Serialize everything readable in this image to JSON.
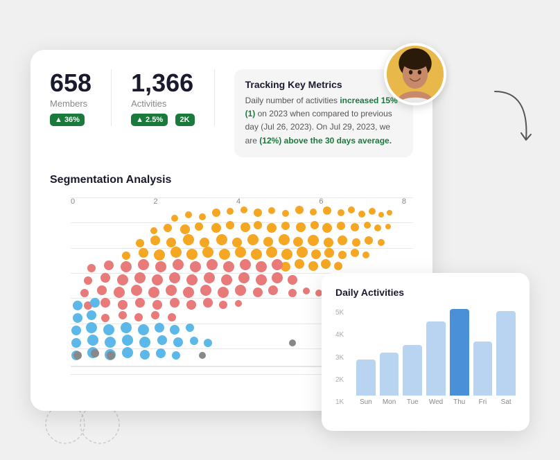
{
  "metrics": {
    "members": {
      "number": "658",
      "label": "Members",
      "badge": "▲ 36%"
    },
    "activities": {
      "number": "1,366",
      "label": "Activities",
      "badge": "▲ 2.5%",
      "badge2": "2K"
    }
  },
  "tracking": {
    "title": "Tracking Key Metrics",
    "text_before": "Daily number of activities ",
    "highlight1": "increased 15% (1)",
    "text_mid1": "\non 2023 when compared to previous day (Jul\n26, 2023). On Jul 29, 2023, we are ",
    "highlight2": "(12%) above\nthe 30 days average.",
    "text_mid2": ""
  },
  "segmentation": {
    "title": "Segmentation Analysis",
    "xLabels": [
      "0",
      "2",
      "4",
      "6",
      "8"
    ]
  },
  "daily": {
    "title": "Daily Activities",
    "yLabels": [
      "5K",
      "4K",
      "3K",
      "2K",
      "1K"
    ],
    "bars": [
      {
        "label": "Sun",
        "value": 2000,
        "active": false
      },
      {
        "label": "Mon",
        "value": 2400,
        "active": false
      },
      {
        "label": "Tue",
        "value": 2800,
        "active": false
      },
      {
        "label": "Wed",
        "value": 4100,
        "active": false
      },
      {
        "label": "Thu",
        "value": 4800,
        "active": true
      },
      {
        "label": "Fri",
        "value": 3000,
        "active": false
      },
      {
        "label": "Sat",
        "value": 4700,
        "active": false
      }
    ],
    "maxValue": 5000
  }
}
